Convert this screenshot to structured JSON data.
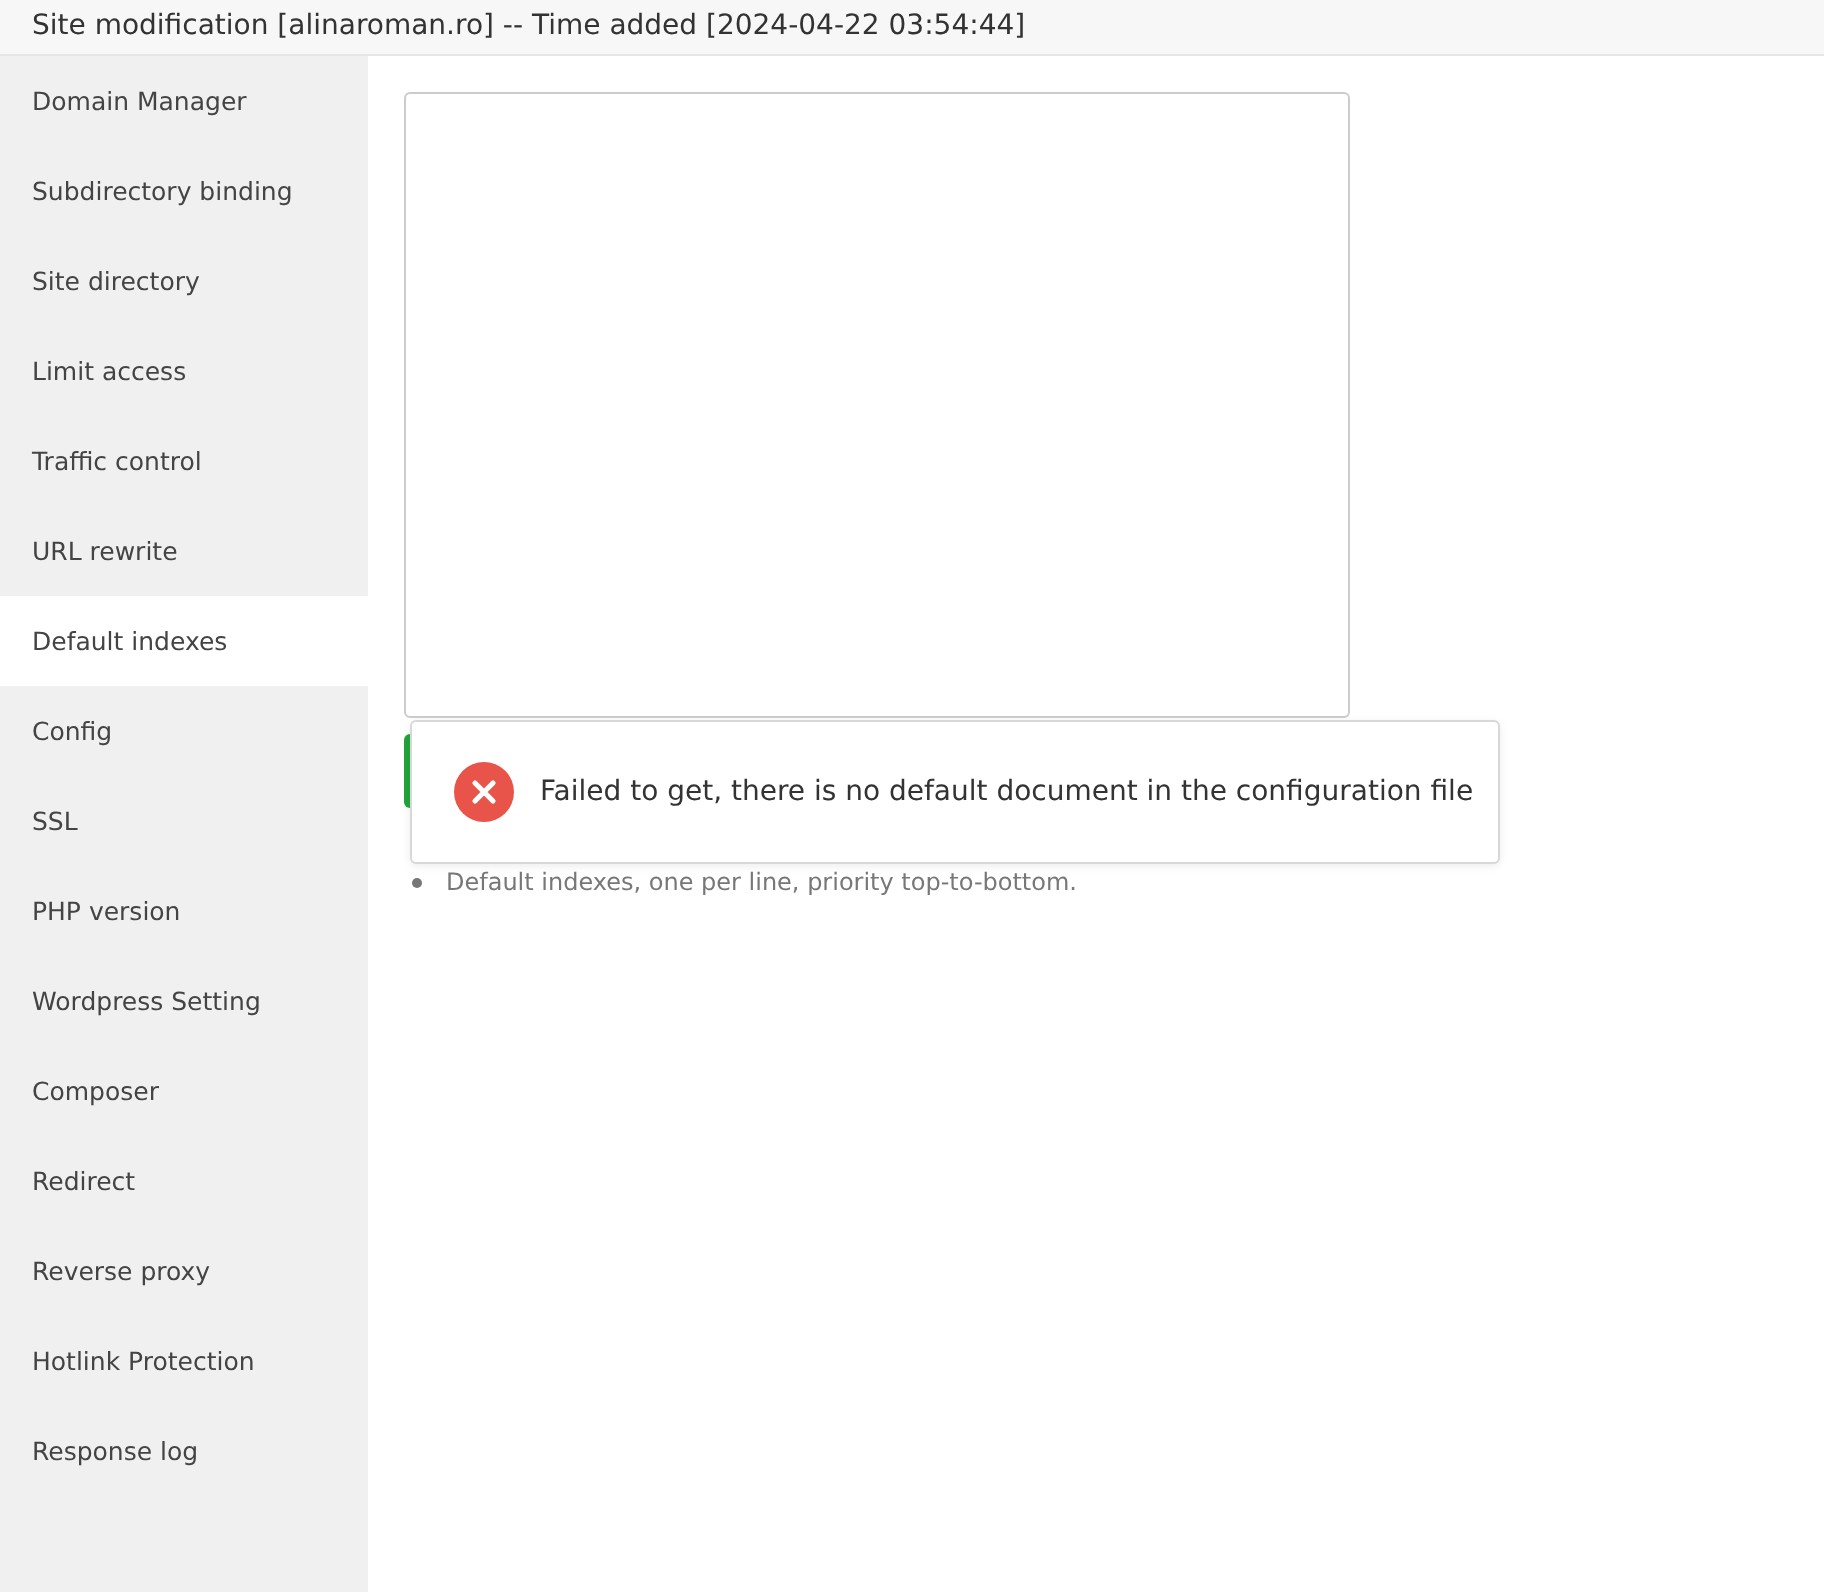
{
  "window": {
    "title": "Site modification [alinaroman.ro] -- Time added [2024-04-22 03:54:44]"
  },
  "sidebar": {
    "items": [
      {
        "label": "Domain Manager",
        "selected": false
      },
      {
        "label": "Subdirectory binding",
        "selected": false
      },
      {
        "label": "Site directory",
        "selected": false
      },
      {
        "label": "Limit access",
        "selected": false
      },
      {
        "label": "Traffic control",
        "selected": false
      },
      {
        "label": "URL rewrite",
        "selected": false
      },
      {
        "label": "Default indexes",
        "selected": true
      },
      {
        "label": "Config",
        "selected": false
      },
      {
        "label": "SSL",
        "selected": false
      },
      {
        "label": "PHP version",
        "selected": false
      },
      {
        "label": "Wordpress Setting",
        "selected": false
      },
      {
        "label": "Composer",
        "selected": false
      },
      {
        "label": "Redirect",
        "selected": false
      },
      {
        "label": "Reverse proxy",
        "selected": false
      },
      {
        "label": "Hotlink Protection",
        "selected": false
      },
      {
        "label": "Response log",
        "selected": false
      }
    ]
  },
  "content": {
    "hints": [
      "Default indexes, one per line, priority top-to-bottom."
    ]
  },
  "toast": {
    "kind": "error",
    "message": "Failed to get, there is no default document in the configuration file"
  }
}
